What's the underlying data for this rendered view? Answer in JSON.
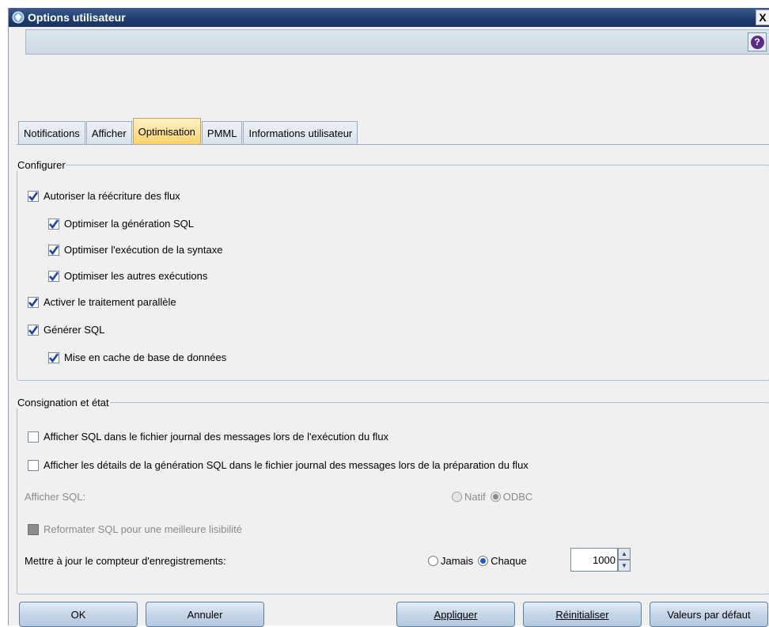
{
  "window": {
    "title": "Options utilisateur",
    "close_label": "X"
  },
  "toolbar": {
    "help_label": "?"
  },
  "tabs": [
    {
      "label": "Notifications",
      "active": false
    },
    {
      "label": "Afficher",
      "active": false
    },
    {
      "label": "Optimisation",
      "active": true
    },
    {
      "label": "PMML",
      "active": false
    },
    {
      "label": "Informations utilisateur",
      "active": false
    }
  ],
  "configure": {
    "legend": "Configurer",
    "items": [
      {
        "label": "Autoriser la réécriture des flux",
        "checked": true
      },
      {
        "label": "Optimiser la génération SQL",
        "checked": true
      },
      {
        "label": "Optimiser l'exécution de la syntaxe",
        "checked": true
      },
      {
        "label": "Optimiser les autres exécutions",
        "checked": true
      },
      {
        "label": "Activer le traitement parallèle",
        "checked": true
      },
      {
        "label": "Générer SQL",
        "checked": true
      },
      {
        "label": "Mise en cache de base de données",
        "checked": true
      }
    ]
  },
  "logging": {
    "legend": "Consignation et état",
    "show_sql_log": {
      "label": "Afficher SQL dans le fichier journal des messages lors de l'exécution du flux",
      "checked": false
    },
    "show_sql_details": {
      "label": "Afficher les détails de la génération SQL dans le fichier journal des messages lors de la préparation du flux",
      "checked": false
    },
    "afficher_sql": {
      "label": "Afficher SQL:",
      "options": [
        "Natif",
        "ODBC"
      ],
      "selected": "ODBC",
      "enabled": false
    },
    "reformat_sql": {
      "label": "Reformater SQL pour une meilleure lisibilité",
      "checked": false,
      "enabled": false
    },
    "record_counter": {
      "label": "Mettre à jour le compteur d'enregistrements:",
      "options": [
        "Jamais",
        "Chaque"
      ],
      "selected": "Chaque",
      "value": "1000"
    }
  },
  "buttons": {
    "ok": "OK",
    "cancel": "Annuler",
    "apply": "Appliquer",
    "reset": "Réinitialiser",
    "defaults": "Valeurs par défaut"
  },
  "colors": {
    "titlebar": "#1f3e71",
    "active_tab": "#ffd36a",
    "accent": "#2356c7"
  }
}
